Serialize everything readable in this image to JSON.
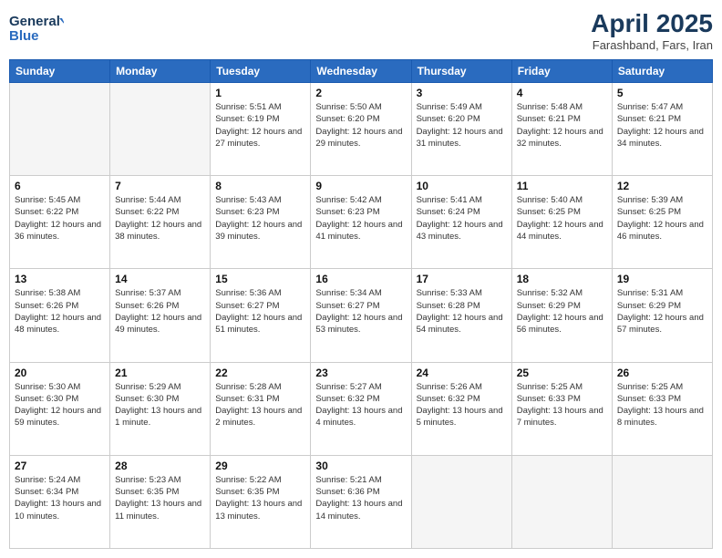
{
  "logo": {
    "line1": "General",
    "line2": "Blue"
  },
  "title": "April 2025",
  "subtitle": "Farashband, Fars, Iran",
  "days": [
    "Sunday",
    "Monday",
    "Tuesday",
    "Wednesday",
    "Thursday",
    "Friday",
    "Saturday"
  ],
  "weeks": [
    [
      {
        "day": "",
        "info": ""
      },
      {
        "day": "",
        "info": ""
      },
      {
        "day": "1",
        "info": "Sunrise: 5:51 AM\nSunset: 6:19 PM\nDaylight: 12 hours and 27 minutes."
      },
      {
        "day": "2",
        "info": "Sunrise: 5:50 AM\nSunset: 6:20 PM\nDaylight: 12 hours and 29 minutes."
      },
      {
        "day": "3",
        "info": "Sunrise: 5:49 AM\nSunset: 6:20 PM\nDaylight: 12 hours and 31 minutes."
      },
      {
        "day": "4",
        "info": "Sunrise: 5:48 AM\nSunset: 6:21 PM\nDaylight: 12 hours and 32 minutes."
      },
      {
        "day": "5",
        "info": "Sunrise: 5:47 AM\nSunset: 6:21 PM\nDaylight: 12 hours and 34 minutes."
      }
    ],
    [
      {
        "day": "6",
        "info": "Sunrise: 5:45 AM\nSunset: 6:22 PM\nDaylight: 12 hours and 36 minutes."
      },
      {
        "day": "7",
        "info": "Sunrise: 5:44 AM\nSunset: 6:22 PM\nDaylight: 12 hours and 38 minutes."
      },
      {
        "day": "8",
        "info": "Sunrise: 5:43 AM\nSunset: 6:23 PM\nDaylight: 12 hours and 39 minutes."
      },
      {
        "day": "9",
        "info": "Sunrise: 5:42 AM\nSunset: 6:23 PM\nDaylight: 12 hours and 41 minutes."
      },
      {
        "day": "10",
        "info": "Sunrise: 5:41 AM\nSunset: 6:24 PM\nDaylight: 12 hours and 43 minutes."
      },
      {
        "day": "11",
        "info": "Sunrise: 5:40 AM\nSunset: 6:25 PM\nDaylight: 12 hours and 44 minutes."
      },
      {
        "day": "12",
        "info": "Sunrise: 5:39 AM\nSunset: 6:25 PM\nDaylight: 12 hours and 46 minutes."
      }
    ],
    [
      {
        "day": "13",
        "info": "Sunrise: 5:38 AM\nSunset: 6:26 PM\nDaylight: 12 hours and 48 minutes."
      },
      {
        "day": "14",
        "info": "Sunrise: 5:37 AM\nSunset: 6:26 PM\nDaylight: 12 hours and 49 minutes."
      },
      {
        "day": "15",
        "info": "Sunrise: 5:36 AM\nSunset: 6:27 PM\nDaylight: 12 hours and 51 minutes."
      },
      {
        "day": "16",
        "info": "Sunrise: 5:34 AM\nSunset: 6:27 PM\nDaylight: 12 hours and 53 minutes."
      },
      {
        "day": "17",
        "info": "Sunrise: 5:33 AM\nSunset: 6:28 PM\nDaylight: 12 hours and 54 minutes."
      },
      {
        "day": "18",
        "info": "Sunrise: 5:32 AM\nSunset: 6:29 PM\nDaylight: 12 hours and 56 minutes."
      },
      {
        "day": "19",
        "info": "Sunrise: 5:31 AM\nSunset: 6:29 PM\nDaylight: 12 hours and 57 minutes."
      }
    ],
    [
      {
        "day": "20",
        "info": "Sunrise: 5:30 AM\nSunset: 6:30 PM\nDaylight: 12 hours and 59 minutes."
      },
      {
        "day": "21",
        "info": "Sunrise: 5:29 AM\nSunset: 6:30 PM\nDaylight: 13 hours and 1 minute."
      },
      {
        "day": "22",
        "info": "Sunrise: 5:28 AM\nSunset: 6:31 PM\nDaylight: 13 hours and 2 minutes."
      },
      {
        "day": "23",
        "info": "Sunrise: 5:27 AM\nSunset: 6:32 PM\nDaylight: 13 hours and 4 minutes."
      },
      {
        "day": "24",
        "info": "Sunrise: 5:26 AM\nSunset: 6:32 PM\nDaylight: 13 hours and 5 minutes."
      },
      {
        "day": "25",
        "info": "Sunrise: 5:25 AM\nSunset: 6:33 PM\nDaylight: 13 hours and 7 minutes."
      },
      {
        "day": "26",
        "info": "Sunrise: 5:25 AM\nSunset: 6:33 PM\nDaylight: 13 hours and 8 minutes."
      }
    ],
    [
      {
        "day": "27",
        "info": "Sunrise: 5:24 AM\nSunset: 6:34 PM\nDaylight: 13 hours and 10 minutes."
      },
      {
        "day": "28",
        "info": "Sunrise: 5:23 AM\nSunset: 6:35 PM\nDaylight: 13 hours and 11 minutes."
      },
      {
        "day": "29",
        "info": "Sunrise: 5:22 AM\nSunset: 6:35 PM\nDaylight: 13 hours and 13 minutes."
      },
      {
        "day": "30",
        "info": "Sunrise: 5:21 AM\nSunset: 6:36 PM\nDaylight: 13 hours and 14 minutes."
      },
      {
        "day": "",
        "info": ""
      },
      {
        "day": "",
        "info": ""
      },
      {
        "day": "",
        "info": ""
      }
    ]
  ]
}
